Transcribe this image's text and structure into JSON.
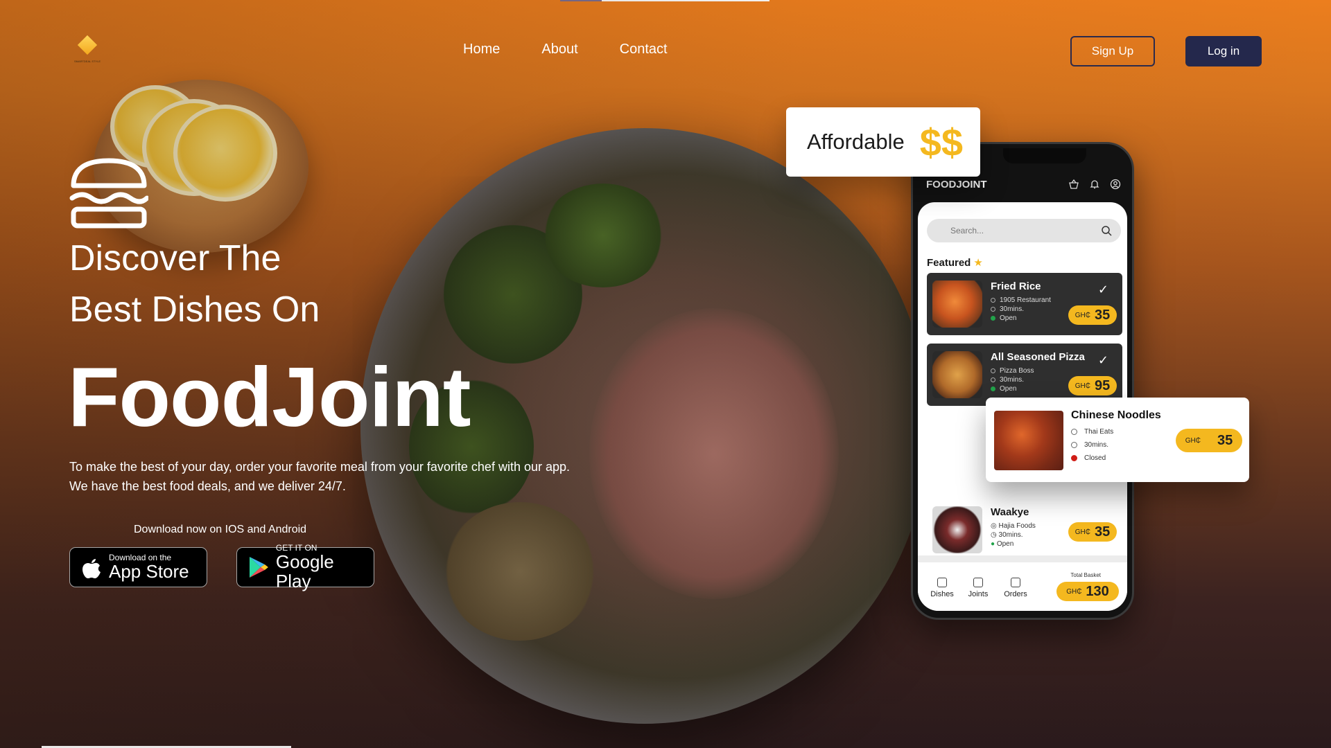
{
  "nav": {
    "links": [
      "Home",
      "About",
      "Contact"
    ],
    "signup": "Sign Up",
    "login": "Log in"
  },
  "hero": {
    "line1": "Discover The",
    "line2": "Best Dishes On",
    "brand": "FoodJoint",
    "desc1": "To make the best of your day, order your favorite meal from your favorite chef with our app.",
    "desc2": "We have the best food deals, and we deliver 24/7.",
    "download_label": "Download now on IOS and Android",
    "appstore_small": "Download on the",
    "appstore_big": "App Store",
    "google_small": "GET IT ON",
    "google_big": "Google Play"
  },
  "affordable": {
    "label": "Affordable",
    "symbol": "$$"
  },
  "phone": {
    "brand": "FOODJOINT",
    "search_placeholder": "Search...",
    "featured": "Featured",
    "currency": "GH₵",
    "items": [
      {
        "name": "Fried Rice",
        "place": "1905 Restaurant",
        "time": "30mins.",
        "status": "Open",
        "price": "35"
      },
      {
        "name": "All Seasoned Pizza",
        "place": "Pizza Boss",
        "time": "30mins.",
        "status": "Open",
        "price": "95"
      },
      {
        "name": "Waakye",
        "place": "Hajia Foods",
        "time": "30mins.",
        "status": "Open",
        "price": "35"
      }
    ],
    "tabs": [
      "Dishes",
      "Joints",
      "Orders"
    ],
    "basket_label": "Total Basket",
    "basket_total": "130"
  },
  "floating_card": {
    "name": "Chinese Noodles",
    "place": "Thai Eats",
    "time": "30mins.",
    "status": "Closed",
    "price": "35"
  },
  "colors": {
    "accent": "#f4b81f",
    "navy": "#24284c",
    "open": "#22a34a",
    "closed": "#d01c16"
  },
  "icons": [
    "logo-icon",
    "burger-icon",
    "apple-icon",
    "google-play-icon",
    "basket-icon",
    "bell-icon",
    "user-icon",
    "search-icon",
    "star-icon",
    "check-icon",
    "location-icon",
    "clock-icon"
  ]
}
